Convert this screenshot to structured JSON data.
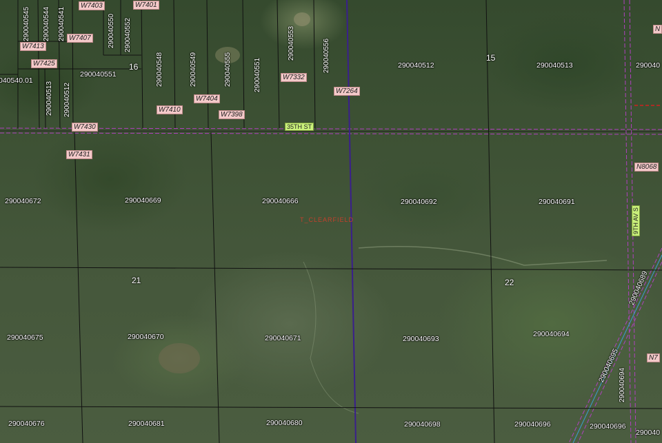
{
  "sections": [
    "16",
    "15",
    "21",
    "22"
  ],
  "town_label": "T_CLEARFIELD",
  "roads": [
    "35TH ST",
    "9TH AV S"
  ],
  "addresses": [
    "W7403",
    "W7401",
    "W7413",
    "W7407",
    "W7425",
    "W7332",
    "W7264",
    "W7404",
    "W7410",
    "W7398",
    "W7430",
    "W7431",
    "N8068",
    "N",
    "N7"
  ],
  "parcels": {
    "top_vertical": [
      "290040545",
      "290040544",
      "290040541",
      "290040550",
      "290040552",
      "290040548",
      "290040549",
      "290040555",
      "290040551",
      "290040553",
      "290040556",
      "290040513",
      "290040512"
    ],
    "top_row": [
      "290040551",
      "290040512",
      "290040513",
      "290040",
      "040540.01"
    ],
    "row1": [
      "290040672",
      "290040669",
      "290040666",
      "290040692",
      "290040691"
    ],
    "row2": [
      "290040675",
      "290040670",
      "290040671",
      "290040693",
      "290040694"
    ],
    "row3": [
      "290040676",
      "290040681",
      "290040680",
      "290040698",
      "290040696",
      "290040696",
      "290040"
    ],
    "diagonal": [
      "290040689",
      "290040695",
      "290040694"
    ]
  },
  "colors": {
    "parcel_line": "#111111",
    "road_line": "#b040c0",
    "section_line": "#3a1f8c",
    "dashed_red": "#d02020"
  }
}
